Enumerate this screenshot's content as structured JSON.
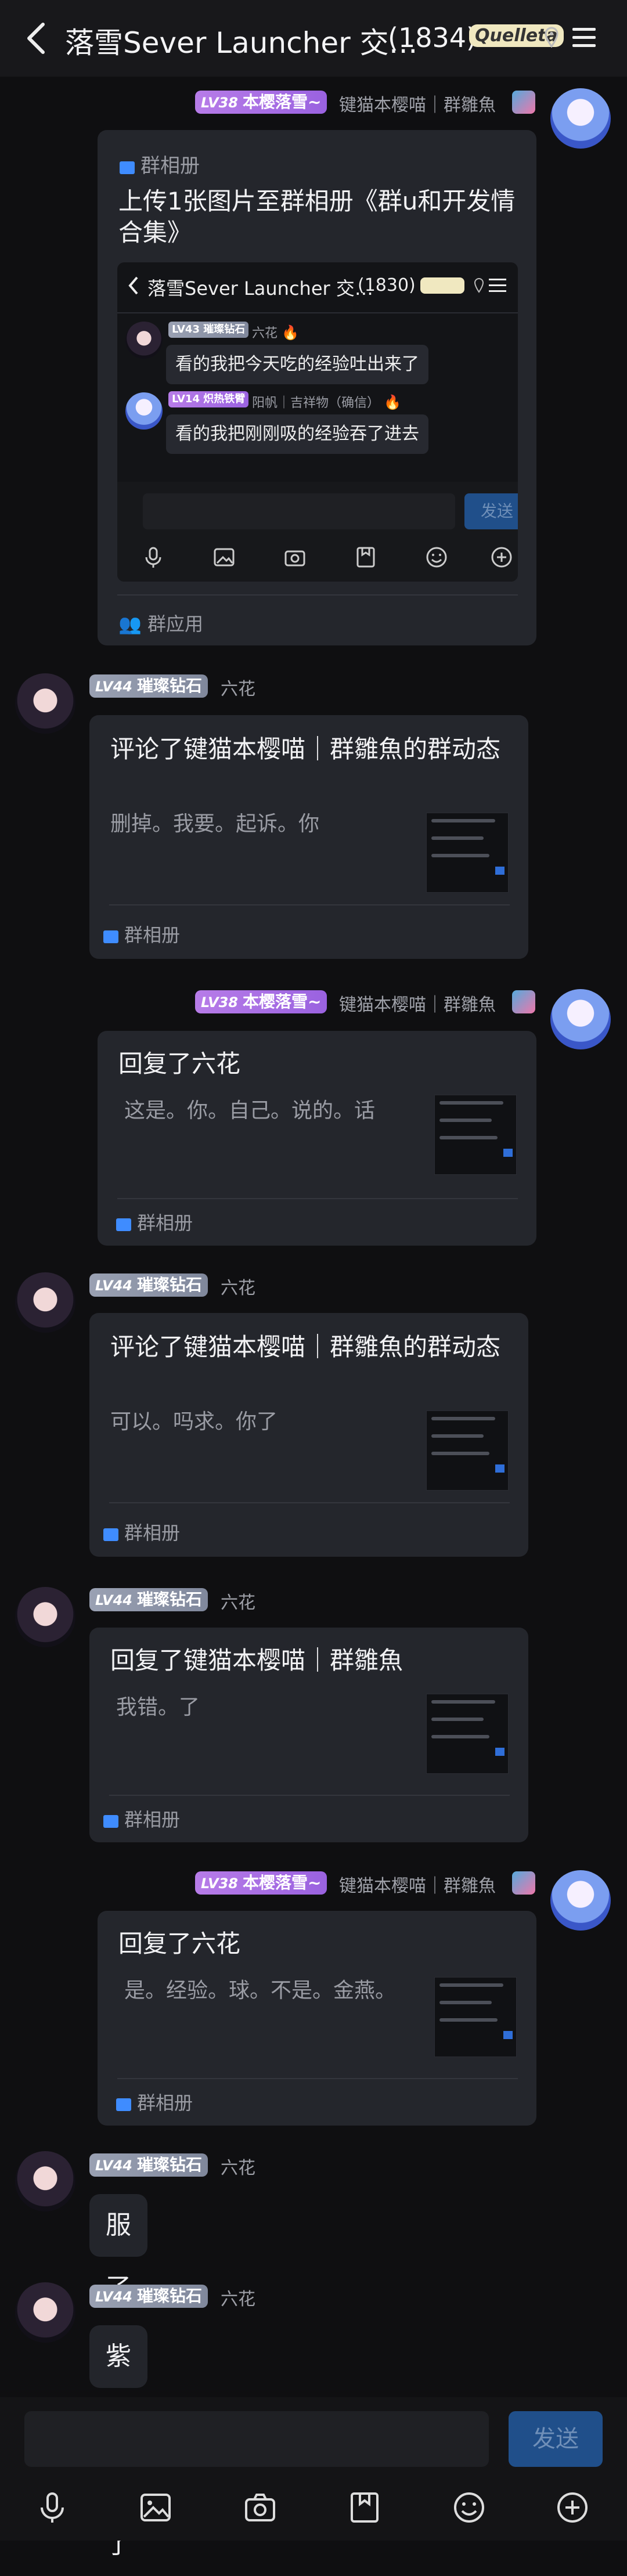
{
  "header": {
    "title": "落雪Sever Launcher 交…",
    "count": "(1834)",
    "badge_art": "Quelleta"
  },
  "users": {
    "a": {
      "level": "LV38",
      "title": "本樱落雪~",
      "nick": "键猫本樱喵｜群雛魚",
      "side": "right"
    },
    "b": {
      "level": "LV44",
      "title": "璀璨钻石",
      "nick": "六花",
      "side": "left"
    }
  },
  "messages": [
    {
      "type": "album-upload",
      "user": "a",
      "source": "群相册",
      "text": "上传1张图片至群相册《群u和开发情合集》",
      "footer": "群应用",
      "inner": {
        "title": "落雪Sever Launcher 交…",
        "count": "(1830)",
        "messages": [
          {
            "level": "LV43",
            "title": "璀璨钻石",
            "nick": "六花",
            "text": "看的我把今天吃的经验吐出来了"
          },
          {
            "level": "LV14",
            "title": "炽热铁臂",
            "nick": "阳帆｜吉祥物（确信）",
            "text": "看的我把刚刚吸的经验吞了进去"
          }
        ],
        "send": "发送"
      }
    },
    {
      "type": "album-card",
      "user": "b",
      "head": "评论了键猫本樱喵｜群雛魚的群动态",
      "body": "删掉。我要。起诉。你",
      "footer": "群相册"
    },
    {
      "type": "album-card",
      "user": "a",
      "head": "回复了六花",
      "body": "这是。你。自己。说的。话",
      "footer": "群相册"
    },
    {
      "type": "album-card",
      "user": "b",
      "head": "评论了键猫本樱喵｜群雛魚的群动态",
      "body": "可以。吗求。你了",
      "footer": "群相册"
    },
    {
      "type": "album-card",
      "user": "b",
      "head": "回复了键猫本樱喵｜群雛魚",
      "body": "我错。了",
      "footer": "群相册"
    },
    {
      "type": "album-card",
      "user": "a",
      "head": "回复了六花",
      "body": "是。经验。球。不是。金燕。",
      "footer": "群相册"
    },
    {
      "type": "text",
      "user": "b",
      "text": "服了"
    },
    {
      "type": "text",
      "user": "b",
      "text": "紫薇去了"
    }
  ],
  "composer": {
    "send": "发送"
  },
  "icons": [
    "back-icon",
    "location-icon",
    "menu-icon",
    "mic-icon",
    "image-icon",
    "camera-icon",
    "bookmark-icon",
    "emoji-icon",
    "plus-icon"
  ]
}
